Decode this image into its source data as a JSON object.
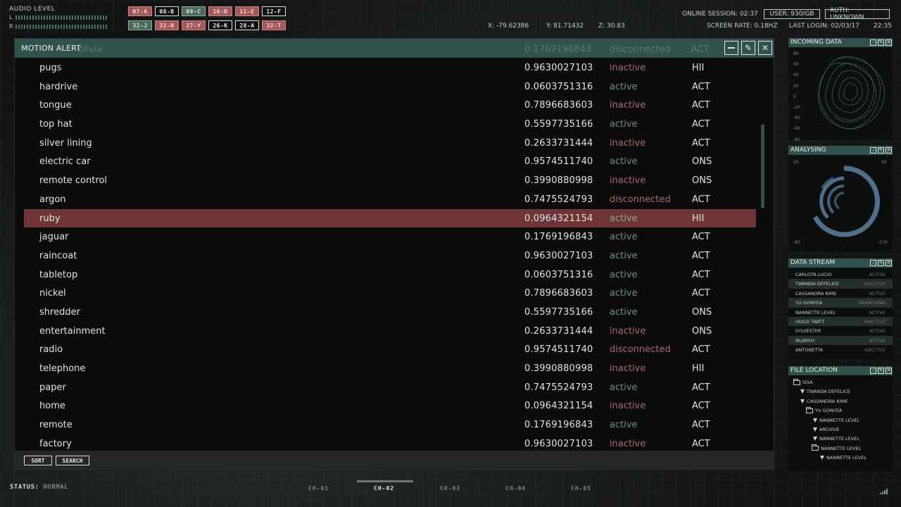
{
  "audio": {
    "label": "AUDIO LEVEL",
    "left": "L",
    "right": "R"
  },
  "tags": [
    {
      "label": "07-A",
      "style": "red"
    },
    {
      "label": "08-B",
      "style": "dark"
    },
    {
      "label": "09-C",
      "style": "green"
    },
    {
      "label": "10-D",
      "style": "red"
    },
    {
      "label": "11-E",
      "style": "red"
    },
    {
      "label": "12-F",
      "style": "dark"
    },
    {
      "label": "32-J",
      "style": "green"
    },
    {
      "label": "32-H",
      "style": "red"
    },
    {
      "label": "27-Y",
      "style": "red"
    },
    {
      "label": "26-K",
      "style": "dark"
    },
    {
      "label": "28-A",
      "style": "dark"
    },
    {
      "label": "32-T",
      "style": "red"
    }
  ],
  "coords": {
    "x": "X: -79.62386",
    "y": "Y: 81.71432",
    "z": "Z: 30.83"
  },
  "header": {
    "online_session": "ONLINE SESSION: 02:37",
    "user": "USER: 930/GB",
    "auth": "AUTH: UNKNOWN",
    "screen_rate": "SCREEN RATE: 0.18HZ",
    "last_login": "LAST LOGIN: 02/03/17",
    "time": "22:35"
  },
  "window": {
    "title": "MOTION ALERT",
    "ghost_row": {
      "name": "olivia",
      "num": "0.1769196843",
      "status": "disconnected",
      "code": "ACT"
    },
    "rows": [
      {
        "name": "pugs",
        "num": "0.9630027103",
        "status": "inactive",
        "code": "HII"
      },
      {
        "name": "hardrive",
        "num": "0.0603751316",
        "status": "active",
        "code": "ACT"
      },
      {
        "name": "tongue",
        "num": "0.7896683603",
        "status": "inactive",
        "code": "ACT"
      },
      {
        "name": "top hat",
        "num": "0.5597735166",
        "status": "active",
        "code": "ACT"
      },
      {
        "name": "silver lining",
        "num": "0.2633731444",
        "status": "inactive",
        "code": "ACT"
      },
      {
        "name": "electric car",
        "num": "0.9574511740",
        "status": "active",
        "code": "ONS"
      },
      {
        "name": "remote control",
        "num": "0.3990880998",
        "status": "inactive",
        "code": "ONS"
      },
      {
        "name": "argon",
        "num": "0.7475524793",
        "status": "disconnected",
        "code": "ACT"
      },
      {
        "name": "ruby",
        "num": "0.0964321154",
        "status": "active",
        "code": "HII",
        "selected": true
      },
      {
        "name": "jaguar",
        "num": "0.1769196843",
        "status": "active",
        "code": "ACT"
      },
      {
        "name": "raincoat",
        "num": "0.9630027103",
        "status": "active",
        "code": "ACT"
      },
      {
        "name": "tabletop",
        "num": "0.0603751316",
        "status": "active",
        "code": "ACT"
      },
      {
        "name": "nickel",
        "num": "0.7896683603",
        "status": "active",
        "code": "ACT"
      },
      {
        "name": "shredder",
        "num": "0.5597735166",
        "status": "active",
        "code": "ONS"
      },
      {
        "name": "entertainment",
        "num": "0.2633731444",
        "status": "inactive",
        "code": "ONS"
      },
      {
        "name": "radio",
        "num": "0.9574511740",
        "status": "disconnected",
        "code": "ACT"
      },
      {
        "name": "telephone",
        "num": "0.3990880998",
        "status": "inactive",
        "code": "HII"
      },
      {
        "name": "paper",
        "num": "0.7475524793",
        "status": "active",
        "code": "ACT"
      },
      {
        "name": "home",
        "num": "0.0964321154",
        "status": "inactive",
        "code": "ACT"
      },
      {
        "name": "remote",
        "num": "0.1769196843",
        "status": "active",
        "code": "ACT"
      },
      {
        "name": "factory",
        "num": "0.9630027103",
        "status": "inactive",
        "code": "ACT"
      }
    ],
    "sort_label": "SORT",
    "search_label": "SEARCH"
  },
  "incoming": {
    "title": "INCOMING DATA",
    "ticks": [
      "80",
      "60",
      "40",
      "20",
      "0",
      "-20",
      "-40",
      "-60",
      "-80"
    ]
  },
  "analysing": {
    "title": "ANALYSING",
    "tl": "20",
    "tr": "40",
    "bl": "-80",
    "br": "-270"
  },
  "data_stream": {
    "title": "DATA STREAM",
    "rows": [
      {
        "name": "CARLOTA LUCIO",
        "status": "ACTIVE"
      },
      {
        "name": "TWANDA DEFELICE",
        "status": "INACTIVE"
      },
      {
        "name": "CASSANDRA KIME",
        "status": "ACTIVE"
      },
      {
        "name": "YU GONYEA",
        "status": "SEARCHING"
      },
      {
        "name": "NANNETTE LEVEL",
        "status": "ACTIVE"
      },
      {
        "name": "HUGO TARTT",
        "status": "INACTIVE"
      },
      {
        "name": "SYLVESTER",
        "status": "ACTIVE"
      },
      {
        "name": "MURPHY",
        "status": "ACTIVE"
      },
      {
        "name": "ANTONETTA",
        "status": "INACTIVE"
      }
    ]
  },
  "file_location": {
    "title": "FILE LOCATION",
    "items": [
      {
        "label": "ISSA",
        "icon": "folder"
      },
      {
        "label": "TWANDA DEFELICE",
        "icon": "triangle"
      },
      {
        "label": "CASSANDRA KIME",
        "icon": "triangle"
      },
      {
        "label": "YU GONYEA",
        "icon": "folder"
      },
      {
        "label": "NANNETTE LEVEL",
        "icon": "triangle"
      },
      {
        "label": "ARCHIVE",
        "icon": "triangle"
      },
      {
        "label": "NANNETTE LEVEL",
        "icon": "triangle"
      },
      {
        "label": "NANNETTE LEVEL",
        "icon": "folder"
      },
      {
        "label": "NANNETTE LEVEL",
        "icon": "triangle"
      }
    ]
  },
  "status": {
    "label": "STATUS:",
    "value": "NORMAL"
  },
  "channels": [
    "CH-01",
    "CH-02",
    "CH-03",
    "CH-04",
    "CH-05"
  ],
  "active_channel": "CH-02"
}
